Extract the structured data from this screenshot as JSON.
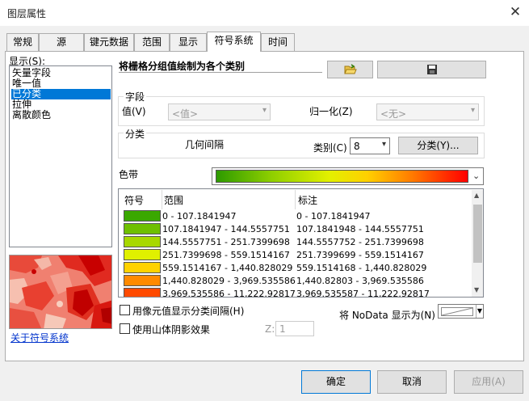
{
  "window": {
    "title": "图层属性"
  },
  "tabs": [
    "常规",
    "源",
    "键元数据",
    "范围",
    "显示",
    "符号系统",
    "时间"
  ],
  "show_label": "显示(S):",
  "show_list": [
    "矢量字段",
    "唯一值",
    "已分类",
    "拉伸",
    "离散颜色"
  ],
  "selected_show_index": 2,
  "heading": "将栅格分组值绘制为各个类别",
  "fields": {
    "group_label": "字段",
    "value_label": "值(V)",
    "value_combo": "<值>",
    "normalize_label": "归一化(Z)",
    "normalize_combo": "<无>"
  },
  "classification": {
    "group_label": "分类",
    "method": "几何间隔",
    "classes_label": "类别(C)",
    "classes_value": "8",
    "classify_button": "分类(Y)..."
  },
  "color_ramp_label": "色带",
  "table": {
    "headers": [
      "符号",
      "范围",
      "标注"
    ],
    "rows": [
      {
        "color": "#3aa800",
        "range": "0 - 107.1841947",
        "label": "0 - 107.1841947"
      },
      {
        "color": "#6fc000",
        "range": "107.1841947 - 144.5557751",
        "label": "107.1841948 - 144.5557751"
      },
      {
        "color": "#a8d800",
        "range": "144.5557751 - 251.7399698",
        "label": "144.5557752 - 251.7399698"
      },
      {
        "color": "#e0f000",
        "range": "251.7399698 - 559.1514167",
        "label": "251.7399699 - 559.1514167"
      },
      {
        "color": "#ffd200",
        "range": "559.1514167 - 1,440.828029",
        "label": "559.1514168 - 1,440.828029"
      },
      {
        "color": "#ff8a00",
        "range": "1,440.828029 - 3,969.535586",
        "label": "1,440.82803 - 3,969.535586"
      },
      {
        "color": "#ff4a00",
        "range": "3,969.535586 - 11,222.92817",
        "label": "3,969.535587 - 11,222.92817"
      }
    ]
  },
  "checkbox_hillshade_interval": "用像元值显示分类间隔(H)",
  "checkbox_hillshade": "使用山体阴影效果",
  "z_label": "Z:",
  "z_value": "1",
  "nodata_label": "将 NoData 显示为(N)",
  "link_text": "关于符号系统",
  "buttons": {
    "ok": "确定",
    "cancel": "取消",
    "apply": "应用(A)"
  }
}
